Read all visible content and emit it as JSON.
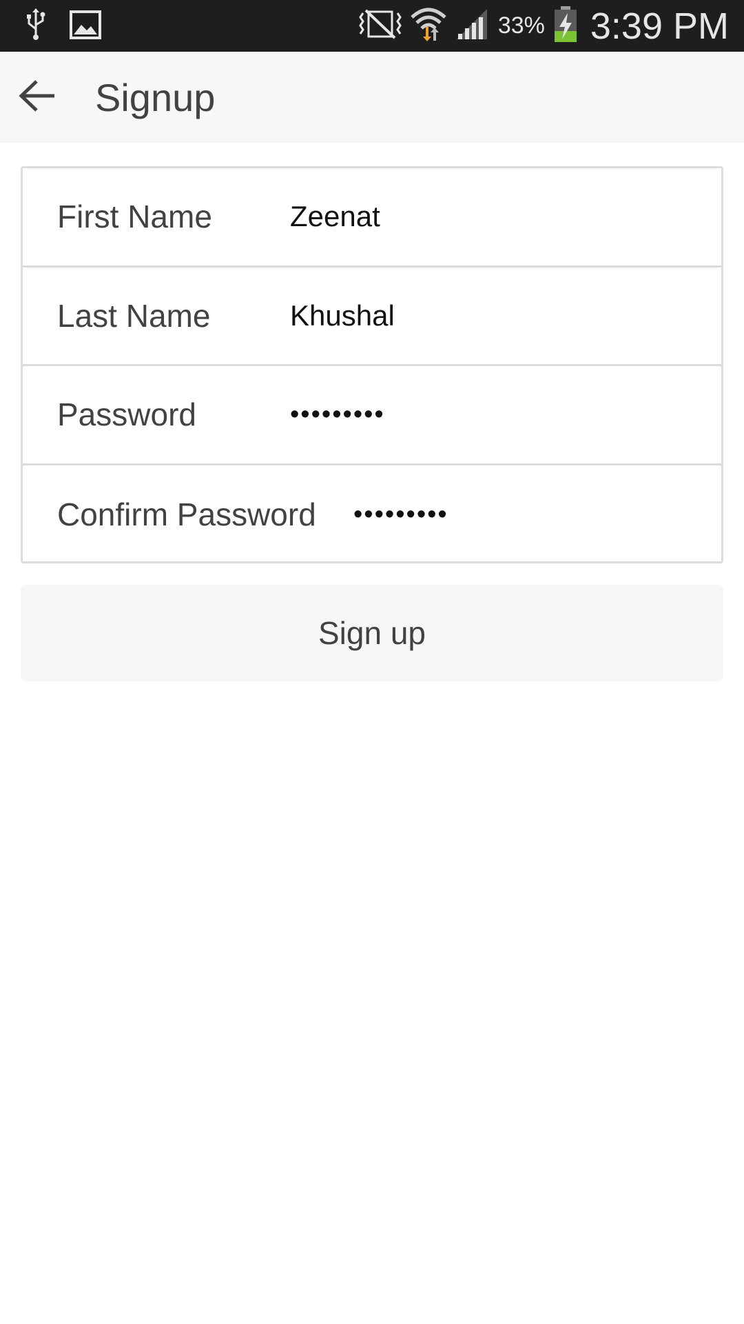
{
  "status_bar": {
    "battery_percent": "33%",
    "time": "3:39 PM",
    "icons": [
      "usb-icon",
      "image-icon",
      "nfc-muted-icon",
      "wifi-icon",
      "signal-icon",
      "battery-charging-icon"
    ]
  },
  "app_bar": {
    "title": "Signup",
    "back_icon": "arrow-left-icon"
  },
  "form": {
    "first_name": {
      "label": "First Name",
      "value": "Zeenat"
    },
    "last_name": {
      "label": "Last Name",
      "value": "Khushal"
    },
    "password": {
      "label": "Password",
      "value": "•••••••••"
    },
    "confirm_password": {
      "label": "Confirm Password",
      "value": "•••••••••"
    }
  },
  "actions": {
    "signup_label": "Sign up"
  },
  "colors": {
    "status_bar_bg": "#1e1e1e",
    "app_bar_bg": "#f7f7f7",
    "text_primary": "#424242",
    "border": "#dcdcdc",
    "battery_green": "#7cc234",
    "wifi_orange": "#f0a030"
  }
}
